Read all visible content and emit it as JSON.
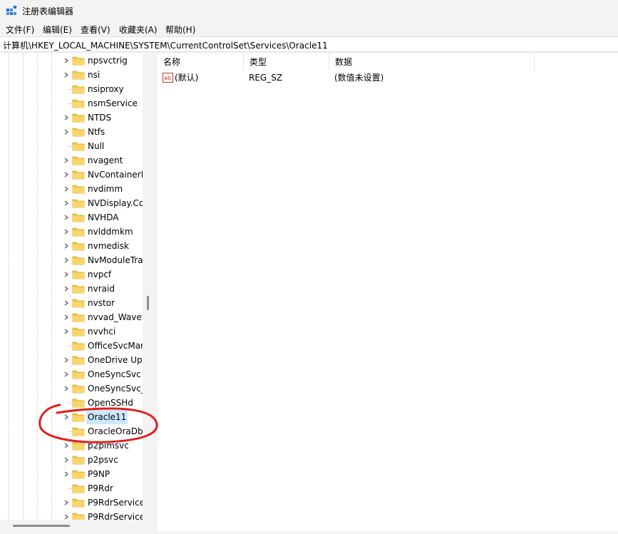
{
  "window": {
    "title": "注册表编辑器"
  },
  "menu": [
    "文件(F)",
    "编辑(E)",
    "查看(V)",
    "收藏夹(A)",
    "帮助(H)"
  ],
  "address": "计算机\\HKEY_LOCAL_MACHINE\\SYSTEM\\CurrentControlSet\\Services\\Oracle11",
  "tree": {
    "items": [
      {
        "label": "npsvctrig",
        "expandable": true
      },
      {
        "label": "nsi",
        "expandable": true
      },
      {
        "label": "nsiproxy",
        "expandable": false
      },
      {
        "label": "nsmService",
        "expandable": false
      },
      {
        "label": "NTDS",
        "expandable": true
      },
      {
        "label": "Ntfs",
        "expandable": true
      },
      {
        "label": "Null",
        "expandable": false
      },
      {
        "label": "nvagent",
        "expandable": true
      },
      {
        "label": "NvContainerLocalSystem",
        "expandable": true
      },
      {
        "label": "nvdimm",
        "expandable": true
      },
      {
        "label": "NVDisplay.ContainerLocalSystem",
        "expandable": true
      },
      {
        "label": "NVHDA",
        "expandable": true
      },
      {
        "label": "nvlddmkm",
        "expandable": true
      },
      {
        "label": "nvmedisk",
        "expandable": true
      },
      {
        "label": "NvModuleTracker",
        "expandable": true
      },
      {
        "label": "nvpcf",
        "expandable": true
      },
      {
        "label": "nvraid",
        "expandable": true
      },
      {
        "label": "nvstor",
        "expandable": true
      },
      {
        "label": "nvvad_WaveExtensible",
        "expandable": true
      },
      {
        "label": "nvvhci",
        "expandable": true
      },
      {
        "label": "OfficeSvcManager",
        "expandable": false
      },
      {
        "label": "OneDrive Updater Service",
        "expandable": true
      },
      {
        "label": "OneSyncSvc",
        "expandable": true
      },
      {
        "label": "OneSyncSvc_",
        "expandable": true
      },
      {
        "label": "OpenSSHd",
        "expandable": false
      },
      {
        "label": "Oracle11",
        "expandable": true,
        "selected": true
      },
      {
        "label": "OracleOraDb",
        "expandable": false
      },
      {
        "label": "p2pimsvc",
        "expandable": true
      },
      {
        "label": "p2psvc",
        "expandable": true
      },
      {
        "label": "P9NP",
        "expandable": true
      },
      {
        "label": "P9Rdr",
        "expandable": false
      },
      {
        "label": "P9RdrService",
        "expandable": true
      },
      {
        "label": "P9RdrService_",
        "expandable": true
      }
    ]
  },
  "list": {
    "columns": [
      "名称",
      "类型",
      "数据"
    ],
    "rows": [
      {
        "name": "(默认)",
        "type": "REG_SZ",
        "data": "(数值未设置)",
        "icon": "string-value-icon"
      }
    ]
  },
  "colors": {
    "selection": "#cce8ff",
    "folder": "#f5c542",
    "annotation": "#e01e1e"
  }
}
